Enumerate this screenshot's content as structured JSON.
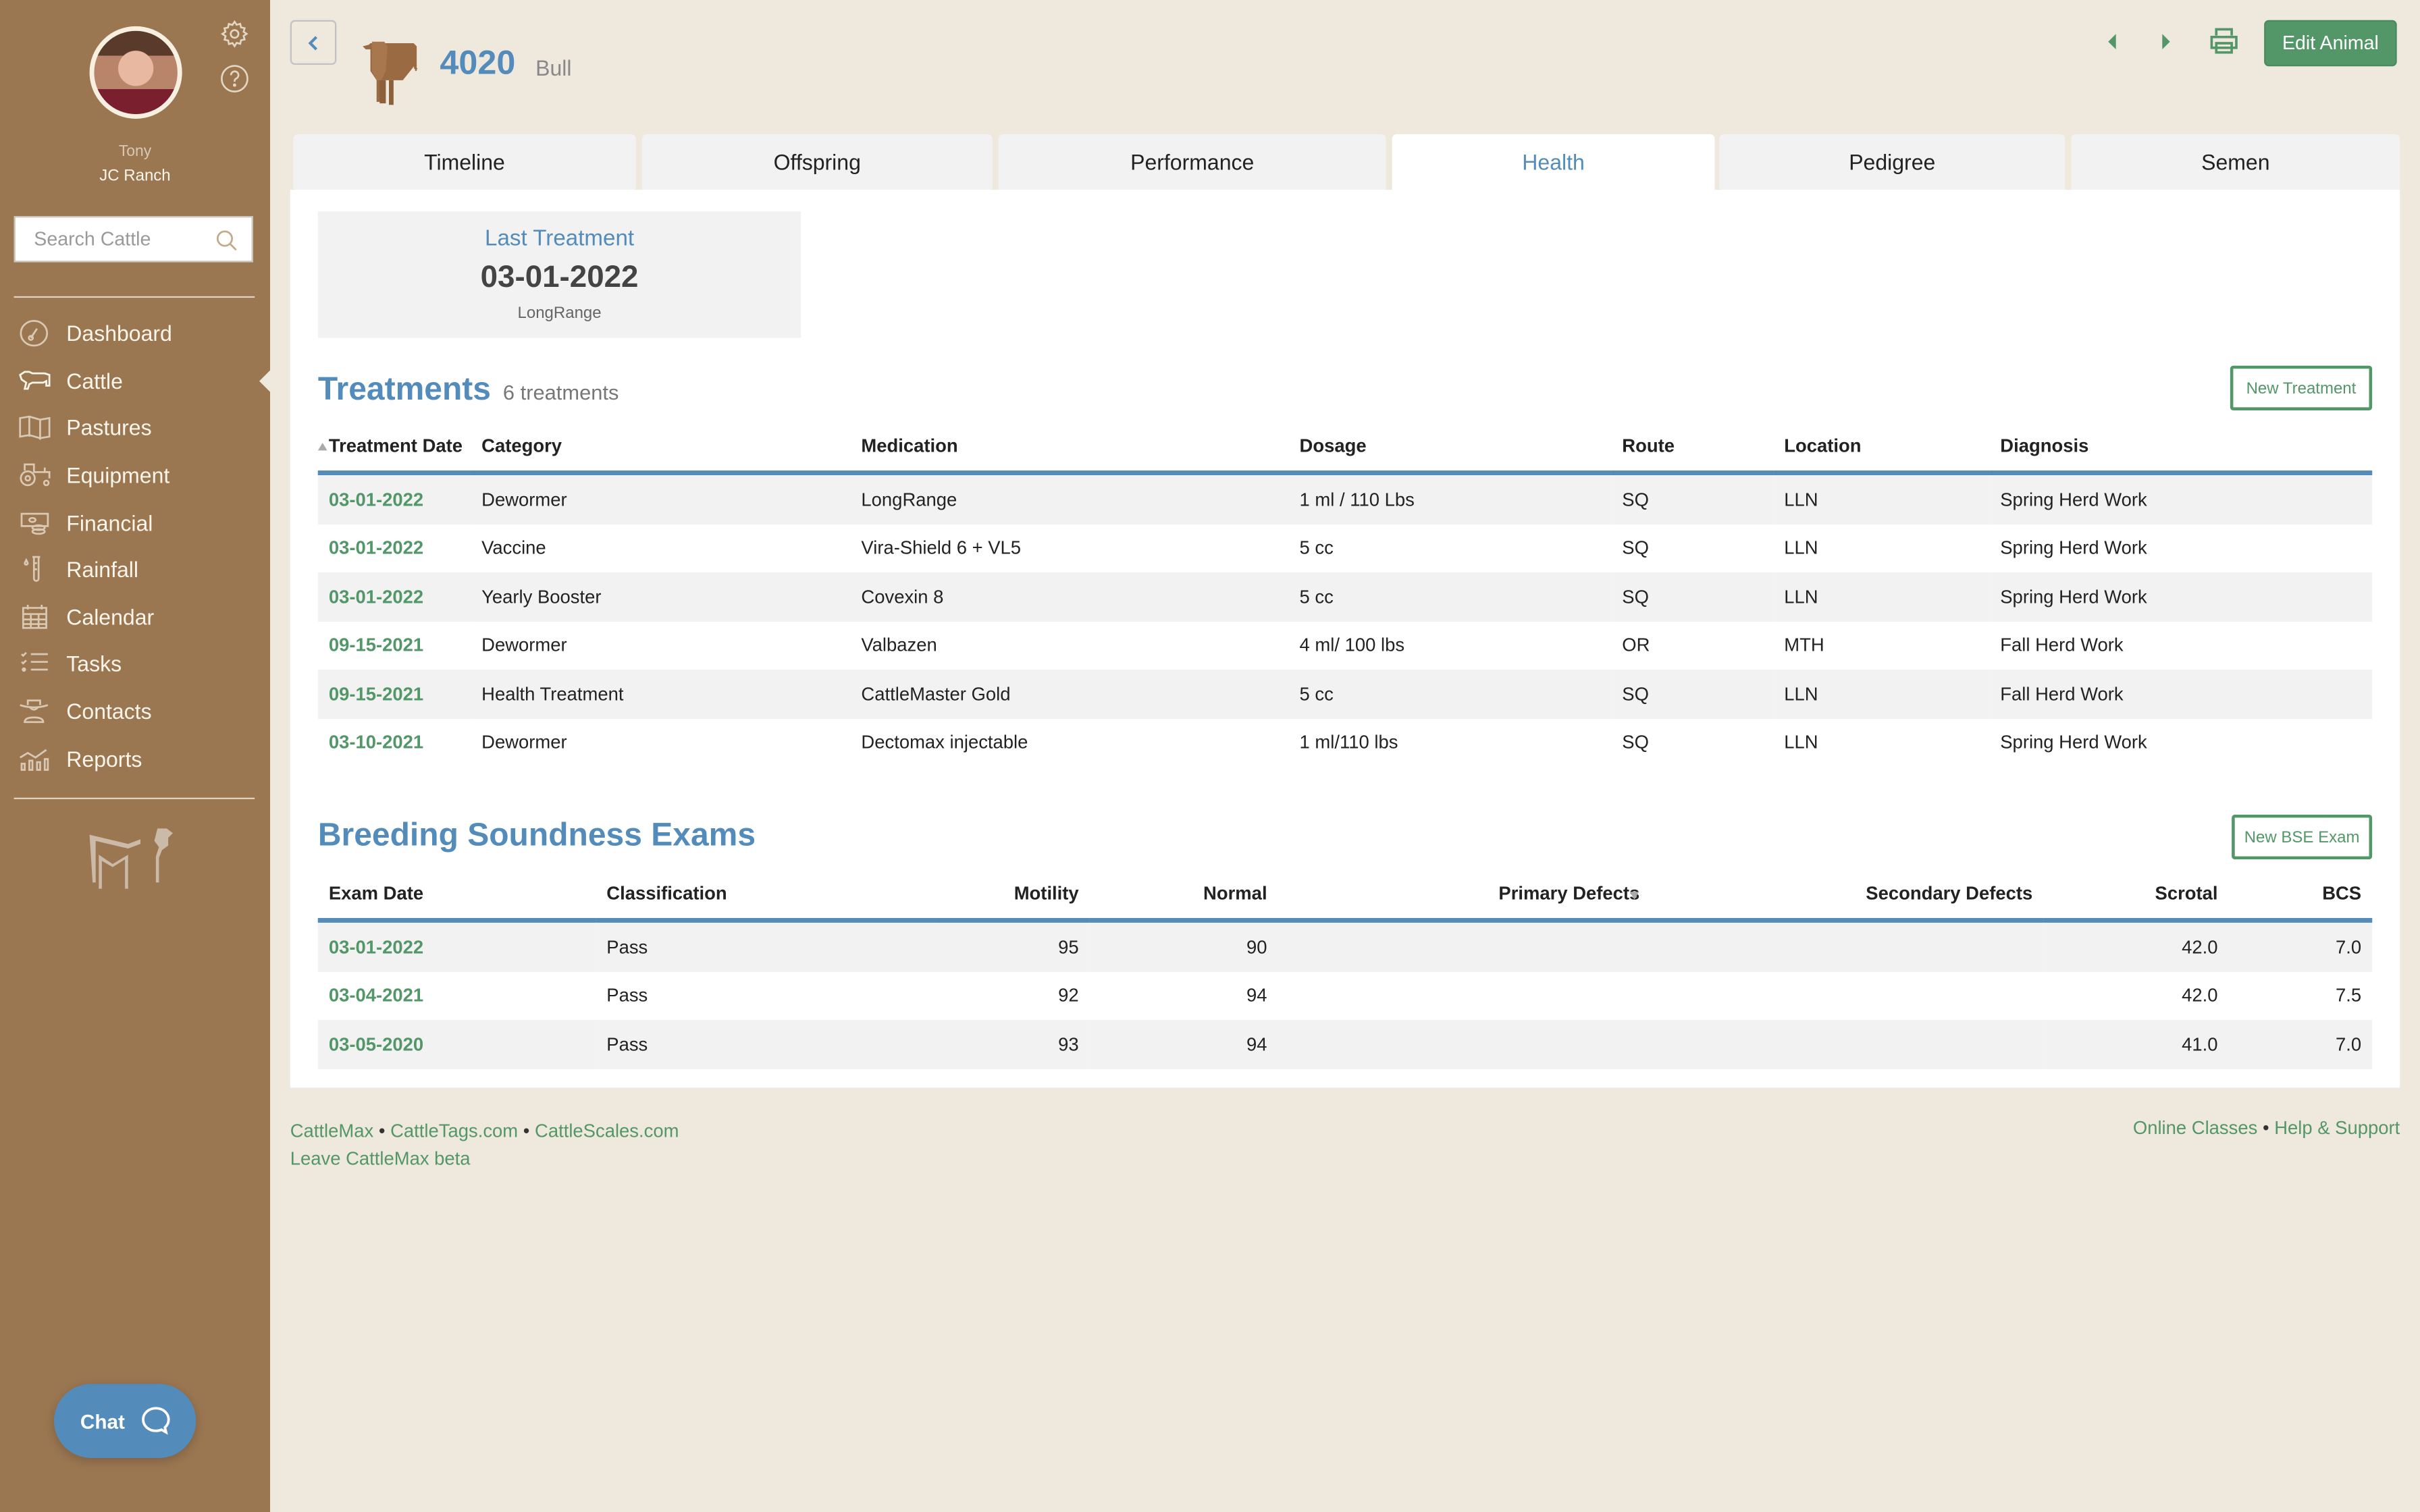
{
  "user": {
    "name": "Tony",
    "ranch": "JC Ranch"
  },
  "search": {
    "placeholder": "Search Cattle",
    "value": ""
  },
  "sidebar": {
    "items": [
      {
        "label": "Dashboard",
        "icon": "gauge-icon"
      },
      {
        "label": "Cattle",
        "icon": "cow-icon",
        "active": true
      },
      {
        "label": "Pastures",
        "icon": "map-icon"
      },
      {
        "label": "Equipment",
        "icon": "tractor-icon"
      },
      {
        "label": "Financial",
        "icon": "money-icon"
      },
      {
        "label": "Rainfall",
        "icon": "rain-gauge-icon"
      },
      {
        "label": "Calendar",
        "icon": "calendar-icon"
      },
      {
        "label": "Tasks",
        "icon": "checklist-icon"
      },
      {
        "label": "Contacts",
        "icon": "cowboy-icon"
      },
      {
        "label": "Reports",
        "icon": "chart-icon"
      }
    ]
  },
  "chat": {
    "label": "Chat"
  },
  "header": {
    "animal_id": "4020",
    "animal_type": "Bull",
    "edit_label": "Edit Animal"
  },
  "tabs": [
    {
      "label": "Timeline"
    },
    {
      "label": "Offspring"
    },
    {
      "label": "Performance"
    },
    {
      "label": "Health",
      "active": true
    },
    {
      "label": "Pedigree"
    },
    {
      "label": "Semen"
    }
  ],
  "last_treatment": {
    "title": "Last Treatment",
    "date": "03-01-2022",
    "medication": "LongRange"
  },
  "treatments": {
    "title": "Treatments",
    "count_label": "6 treatments",
    "new_label": "New Treatment",
    "columns": [
      "Treatment Date",
      "Category",
      "Medication",
      "Dosage",
      "Route",
      "Location",
      "Diagnosis"
    ],
    "rows": [
      [
        "03-01-2022",
        "Dewormer",
        "LongRange",
        "1 ml / 110 Lbs",
        "SQ",
        "LLN",
        "Spring Herd Work"
      ],
      [
        "03-01-2022",
        "Vaccine",
        "Vira-Shield 6 + VL5",
        "5 cc",
        "SQ",
        "LLN",
        "Spring Herd Work"
      ],
      [
        "03-01-2022",
        "Yearly Booster",
        "Covexin 8",
        "5 cc",
        "SQ",
        "LLN",
        "Spring Herd Work"
      ],
      [
        "09-15-2021",
        "Dewormer",
        "Valbazen",
        "4 ml/ 100 lbs",
        "OR",
        "MTH",
        "Fall Herd Work"
      ],
      [
        "09-15-2021",
        "Health Treatment",
        "CattleMaster Gold",
        "5 cc",
        "SQ",
        "LLN",
        "Fall Herd Work"
      ],
      [
        "03-10-2021",
        "Dewormer",
        "Dectomax injectable",
        "1 ml/110 lbs",
        "SQ",
        "LLN",
        "Spring Herd Work"
      ]
    ]
  },
  "bse": {
    "title": "Breeding Soundness Exams",
    "new_label": "New BSE Exam",
    "columns": [
      "Exam Date",
      "Classification",
      "Motility",
      "Normal",
      "Primary Defects",
      "Secondary Defects",
      "Scrotal",
      "BCS"
    ],
    "rows": [
      [
        "03-01-2022",
        "Pass",
        "95",
        "90",
        "",
        "",
        "42.0",
        "7.0"
      ],
      [
        "03-04-2021",
        "Pass",
        "92",
        "94",
        "",
        "",
        "42.0",
        "7.5"
      ],
      [
        "03-05-2020",
        "Pass",
        "93",
        "94",
        "",
        "",
        "41.0",
        "7.0"
      ]
    ]
  },
  "footer": {
    "left_links": [
      "CattleMax",
      "CattleTags.com",
      "CattleScales.com"
    ],
    "beta_link": "Leave CattleMax beta",
    "right_links": [
      "Online Classes",
      "Help & Support"
    ],
    "separator": "•"
  },
  "colors": {
    "sidebar": "#9a7651",
    "accent_blue": "#538cbb",
    "accent_green": "#539769",
    "background": "#efe8dd"
  }
}
